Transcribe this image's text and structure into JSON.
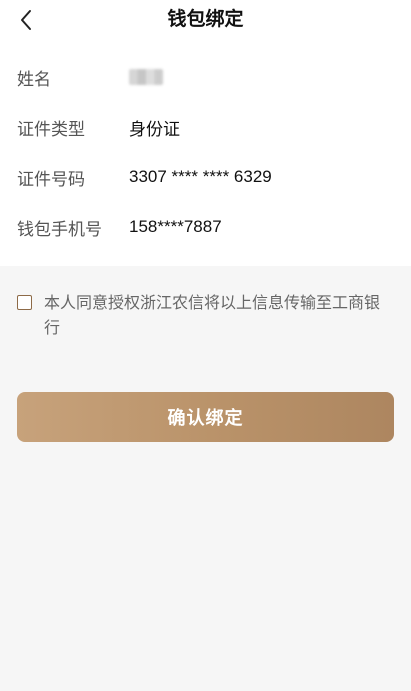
{
  "header": {
    "back_icon": "chevron-left-icon",
    "title": "钱包绑定"
  },
  "info": {
    "rows": [
      {
        "label": "姓名",
        "value": ""
      },
      {
        "label": "证件类型",
        "value": "身份证"
      },
      {
        "label": "证件号码",
        "value": "3307 **** **** 6329"
      },
      {
        "label": "钱包手机号",
        "value": "158****7887"
      }
    ]
  },
  "consent": {
    "checked": false,
    "text": "本人同意授权浙江农信将以上信息传输至工商银行"
  },
  "actions": {
    "confirm_label": "确认绑定"
  },
  "colors": {
    "button_start": "#c7a27b",
    "button_end": "#ad8660",
    "page_background": "#f6f6f6"
  }
}
